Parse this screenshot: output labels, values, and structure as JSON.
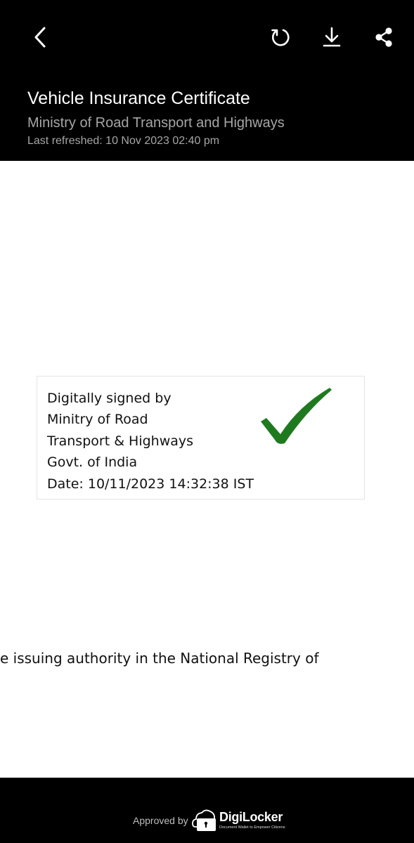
{
  "header": {
    "title": "Vehicle Insurance Certificate",
    "issuer": "Ministry of Road Transport and Highways",
    "last_refreshed": "Last refreshed: 10 Nov 2023 02:40 pm"
  },
  "toolbar": {
    "back_icon": "back-arrow-icon",
    "refresh_icon": "refresh-icon",
    "download_icon": "download-icon",
    "share_icon": "share-icon"
  },
  "document": {
    "signature": {
      "lines": [
        "Digitally signed by",
        "Minitry of Road",
        "Transport & Highways",
        "Govt. of India",
        "Date: 10/11/2023 14:32:38 IST"
      ],
      "check_color": "#1f7a1f"
    },
    "body_text": "e issuing authority in the National Registry of"
  },
  "footer": {
    "approved_label": "Approved by",
    "brand_name": "DigiLocker",
    "brand_tagline": "Document Wallet to Empower Citizens"
  }
}
